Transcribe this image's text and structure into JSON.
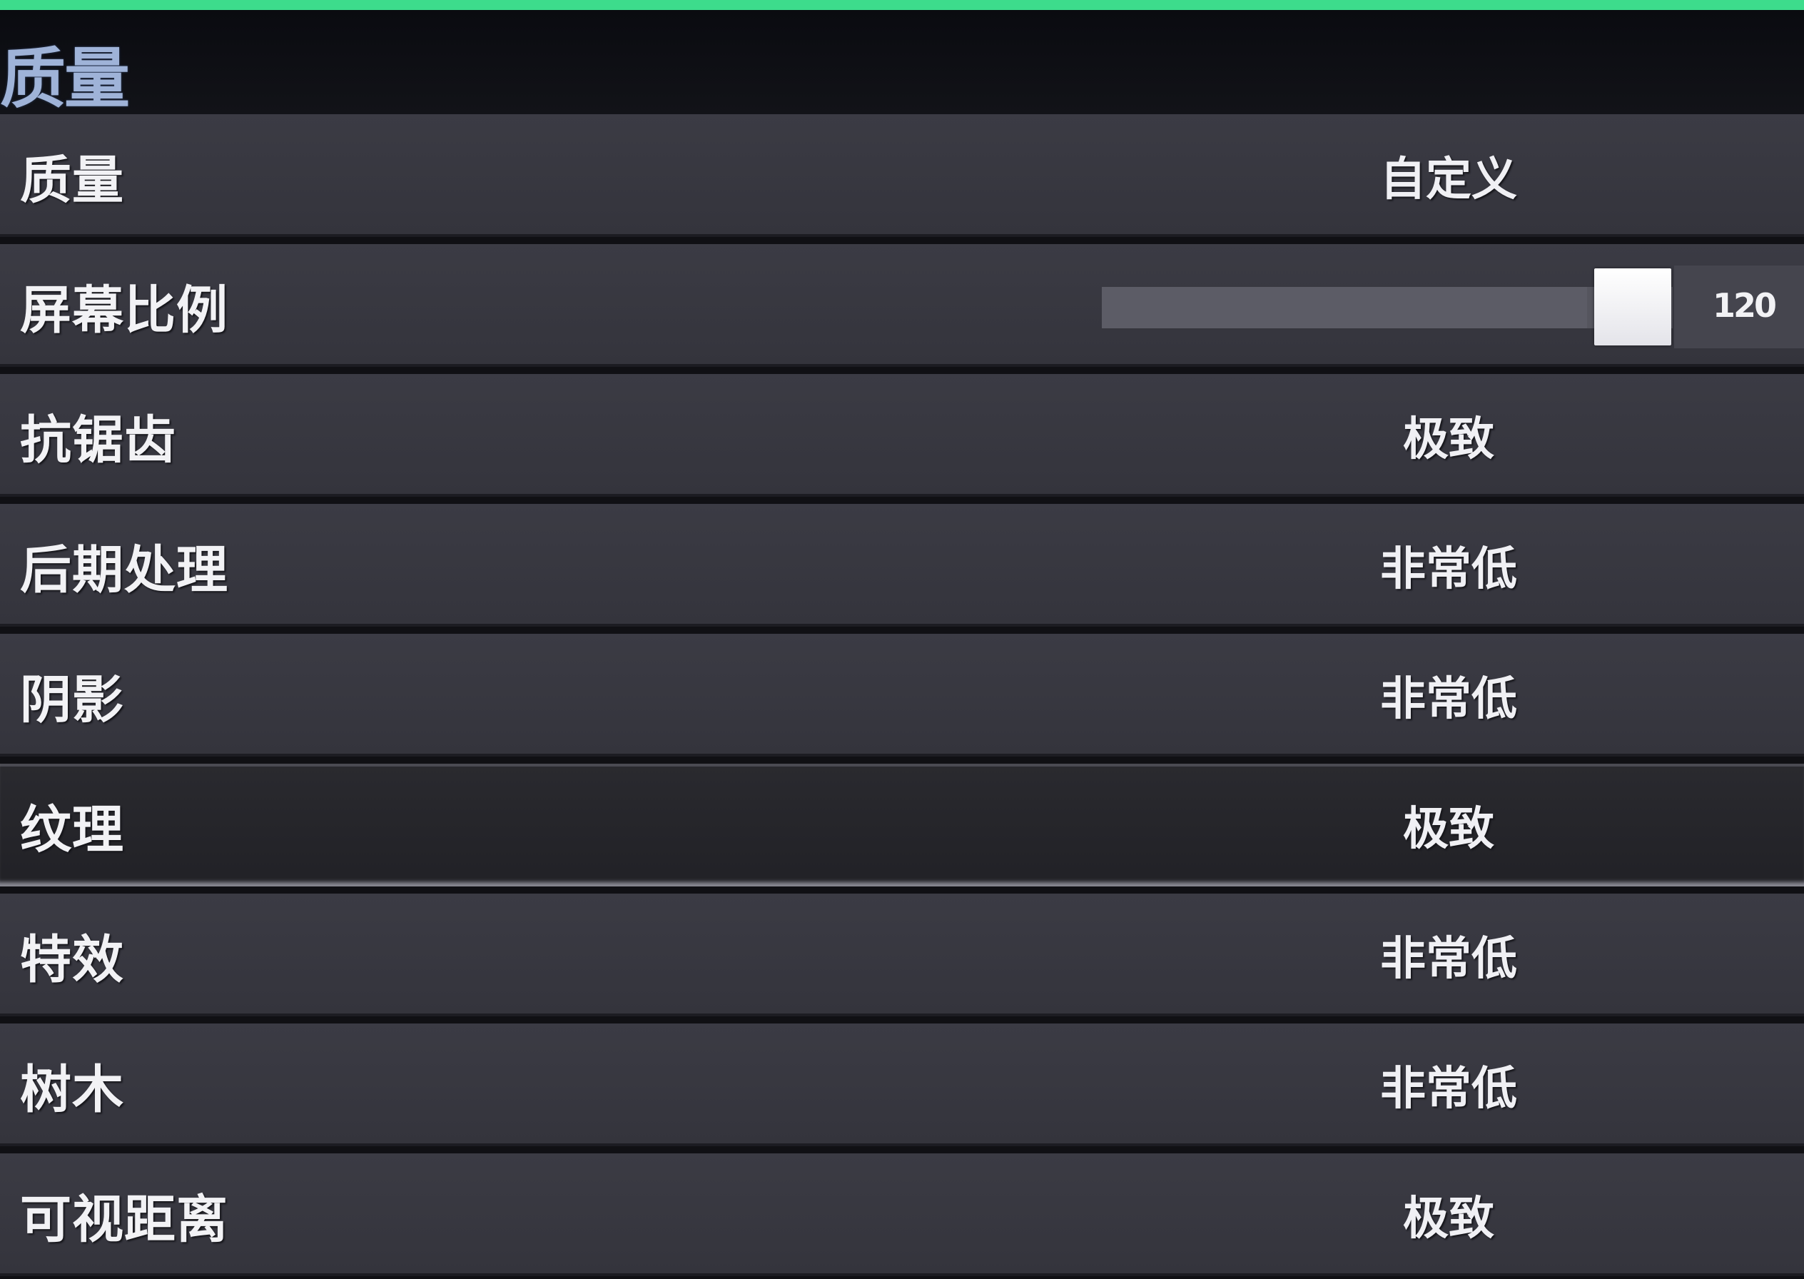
{
  "header": {
    "title": "质量"
  },
  "settings": [
    {
      "label": "质量",
      "value": "自定义"
    },
    {
      "label": "屏幕比例",
      "slider_value": "120",
      "slider_fraction": 0.85
    },
    {
      "label": "抗锯齿",
      "value": "极致"
    },
    {
      "label": "后期处理",
      "value": "非常低"
    },
    {
      "label": "阴影",
      "value": "非常低"
    },
    {
      "label": "纹理",
      "value": "极致",
      "selected": true
    },
    {
      "label": "特效",
      "value": "非常低"
    },
    {
      "label": "树木",
      "value": "非常低"
    },
    {
      "label": "可视距离",
      "value": "极致"
    }
  ],
  "colors": {
    "accent": "#3ddc8c",
    "row_bg": "#38383f",
    "selected_row_bg": "#26262b",
    "title": "#9fb3d8"
  }
}
